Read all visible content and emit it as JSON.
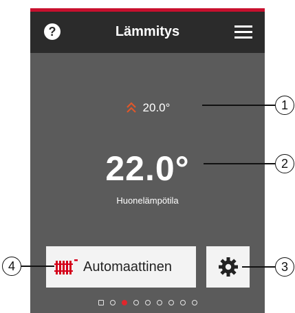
{
  "header": {
    "title": "Lämmitys",
    "help_icon_glyph": "?",
    "help_icon": "help-icon",
    "menu_icon": "menu-icon"
  },
  "main": {
    "setpoint": "20.0°",
    "setpoint_icon": "double-chevron-up-icon",
    "room_temperature": "22.0°",
    "room_temperature_label": "Huonelämpötila"
  },
  "mode_button": {
    "label": "Automaattinen",
    "icon": "radiator-icon"
  },
  "settings_button": {
    "icon": "gear-icon"
  },
  "pager": {
    "pages": 9,
    "active_index": 2
  },
  "callouts": [
    "1",
    "2",
    "3",
    "4"
  ],
  "colors": {
    "accent": "#c8102e",
    "header_bg": "#2b2b2b",
    "screen_bg": "#5b5b5b",
    "button_bg": "#f3f3f3",
    "chevron": "#e0572a",
    "radiator": "#d4001a"
  }
}
